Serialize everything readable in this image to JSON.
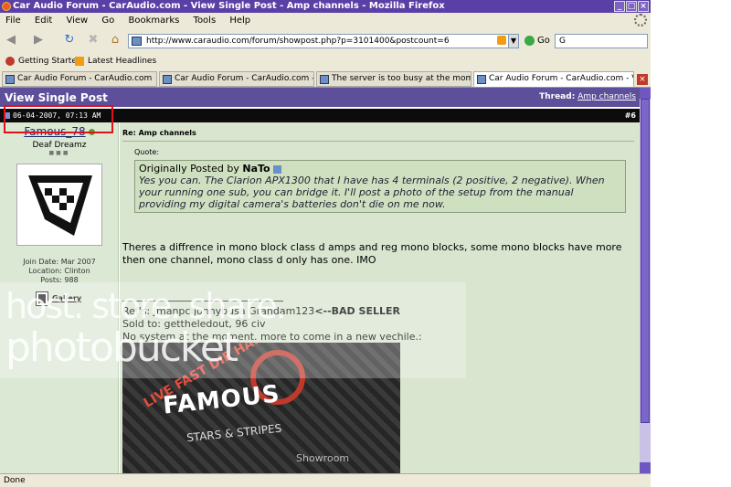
{
  "window": {
    "title": "Car Audio Forum - CarAudio.com - View Single Post - Amp channels - Mozilla Firefox"
  },
  "menu": [
    "File",
    "Edit",
    "View",
    "Go",
    "Bookmarks",
    "Tools",
    "Help"
  ],
  "nav": {
    "url": "http://www.caraudio.com/forum/showpost.php?p=3101400&postcount=6",
    "go_label": "Go",
    "search_value": "G"
  },
  "bookmarks": [
    "Getting Started",
    "Latest Headlines"
  ],
  "tabs": [
    "Car Audio Forum - CarAudio.com",
    "Car Audio Forum - CarAudio.com - Re...",
    "The server is too busy at the moment...",
    "Car Audio Forum - CarAudio.com - Vi..."
  ],
  "page": {
    "heading": "View Single Post",
    "thread_label": "Thread:",
    "thread_link": "Amp channels",
    "post_date": "06-04-2007, 07:13 AM",
    "post_number": "#6",
    "user": {
      "name": "Famous_78",
      "title": "Deaf Dreamz",
      "join_date": "Join Date: Mar 2007",
      "location": "Location: Clinton",
      "posts": "Posts: 988",
      "gallery": "Gallery"
    },
    "post_title": "Re: Amp channels",
    "quote_label": "Quote:",
    "quote_prefix": "Originally Posted by",
    "quote_author": "NaTo",
    "quote_text": "Yes you can. The Clarion APX1300 that I have has 4 terminals (2 positive, 2 negative). When your running one sub, you can bridge it. I'll post a photo of the setup from the manual providing my digital camera's batteries don't die on me now.",
    "post_text": "Theres a diffrence in mono block class d amps and reg mono blocks, some mono blocks have more then one channel, mono class d only has one. IMO",
    "sig_refs": "Ref's: Jmanpc jonnybusa Grandam123",
    "sig_bad": "<--BAD SELLER",
    "sig_sold": "Sold to: gettheledout, 96 civ",
    "sig_system": "No system at the moment. more to come in a new vechile.:",
    "sig_image_text": "FAMOUS",
    "sig_image_sub": "LIVE FAST DIE HARD",
    "sig_image_tag": "STARS & STRIPES",
    "sig_image_show": "Showroom"
  },
  "watermark": {
    "line1": "host. store. share.",
    "line2": "photobucket"
  },
  "status": "Done"
}
